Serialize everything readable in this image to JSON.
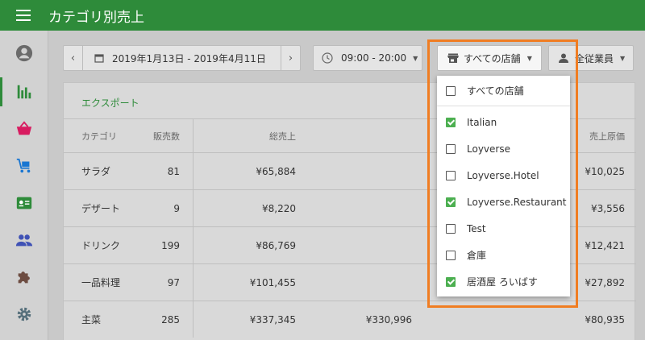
{
  "header": {
    "title": "カテゴリ別売上"
  },
  "filters": {
    "date_range": "2019年1月13日 - 2019年4月11日",
    "time_range": "09:00 - 20:00",
    "store": "すべての店舗",
    "staff": "全従業員"
  },
  "report": {
    "export_label": "エクスポート",
    "columns": {
      "category": "カテゴリ",
      "items_sold": "販売数",
      "gross_sales": "総売上",
      "cost_of_goods": "売上原価"
    },
    "rows": [
      {
        "category": "サラダ",
        "items_sold": "81",
        "gross_sales": "¥65,884",
        "net_sales": "",
        "cost": "¥10,025"
      },
      {
        "category": "デザート",
        "items_sold": "9",
        "gross_sales": "¥8,220",
        "net_sales": "",
        "cost": "¥3,556"
      },
      {
        "category": "ドリンク",
        "items_sold": "199",
        "gross_sales": "¥86,769",
        "net_sales": "",
        "cost": "¥12,421"
      },
      {
        "category": "一品料理",
        "items_sold": "97",
        "gross_sales": "¥101,455",
        "net_sales": "",
        "cost": "¥27,892"
      },
      {
        "category": "主菜",
        "items_sold": "285",
        "gross_sales": "¥337,345",
        "net_sales": "¥330,996",
        "cost": "¥80,935"
      }
    ]
  },
  "store_dropdown": {
    "all_label": "すべての店舗",
    "options": [
      {
        "label": "Italian",
        "checked": true
      },
      {
        "label": "Loyverse",
        "checked": false
      },
      {
        "label": "Loyverse.Hotel",
        "checked": false
      },
      {
        "label": "Loyverse.Restaurant",
        "checked": true
      },
      {
        "label": "Test",
        "checked": false
      },
      {
        "label": "倉庫",
        "checked": false
      },
      {
        "label": "居酒屋 ろいばす",
        "checked": true
      }
    ]
  },
  "colors": {
    "brand": "#2e8b3a",
    "highlight": "#f07d22",
    "checkbox": "#4caf50"
  },
  "icons": [
    "menu-icon",
    "account-icon",
    "bar-chart-icon",
    "basket-icon",
    "cart-icon",
    "id-card-icon",
    "people-icon",
    "puzzle-icon",
    "gear-icon",
    "calendar-icon",
    "clock-icon",
    "store-icon",
    "person-icon"
  ]
}
